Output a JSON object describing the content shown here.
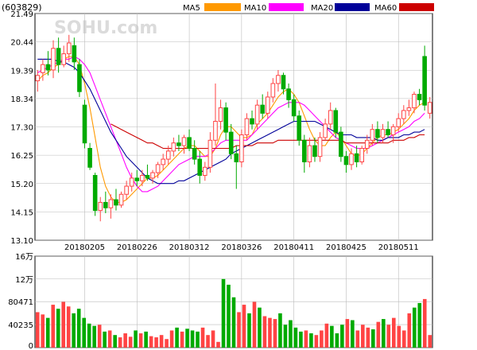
{
  "stock_code": "(603829)",
  "watermark": "SOHU.com",
  "legend": [
    {
      "label": "MA5",
      "color": "#ff9900"
    },
    {
      "label": "MA10",
      "color": "#ff00ff"
    },
    {
      "label": "MA20",
      "color": "#000099"
    },
    {
      "label": "MA60",
      "color": "#cc0000"
    }
  ],
  "colors": {
    "up": "#ff4444",
    "down": "#00aa00",
    "grid": "#bbbbbb",
    "border": "#000000"
  },
  "chart_data": [
    {
      "type": "candlestick",
      "title": "(603829)",
      "ylim": [
        13.1,
        21.49
      ],
      "yticks": [
        "21.49",
        "20.44",
        "19.39",
        "18.34",
        "17.30",
        "16.25",
        "15.20",
        "14.15",
        "13.10"
      ],
      "xtick_labels": [
        "20180205",
        "20180226",
        "20180312",
        "20180326",
        "20180411",
        "20180425",
        "20180511"
      ],
      "xtick_index": [
        9,
        19,
        29,
        39,
        49,
        59,
        69
      ],
      "candles": [
        {
          "o": 19.0,
          "h": 19.4,
          "l": 18.6,
          "c": 19.2
        },
        {
          "o": 19.3,
          "h": 19.8,
          "l": 19.0,
          "c": 19.6
        },
        {
          "o": 19.6,
          "h": 20.1,
          "l": 19.2,
          "c": 19.4
        },
        {
          "o": 19.4,
          "h": 20.5,
          "l": 19.1,
          "c": 20.2
        },
        {
          "o": 20.2,
          "h": 20.6,
          "l": 19.3,
          "c": 19.6
        },
        {
          "o": 19.6,
          "h": 20.3,
          "l": 19.5,
          "c": 20.0
        },
        {
          "o": 20.0,
          "h": 20.7,
          "l": 19.7,
          "c": 20.4
        },
        {
          "o": 20.3,
          "h": 20.6,
          "l": 19.4,
          "c": 19.7
        },
        {
          "o": 19.6,
          "h": 19.8,
          "l": 18.4,
          "c": 18.6
        },
        {
          "o": 18.1,
          "h": 18.3,
          "l": 16.5,
          "c": 16.7
        },
        {
          "o": 16.5,
          "h": 16.7,
          "l": 15.7,
          "c": 15.8
        },
        {
          "o": 15.5,
          "h": 15.6,
          "l": 14.0,
          "c": 14.2
        },
        {
          "o": 14.2,
          "h": 14.7,
          "l": 13.8,
          "c": 14.5
        },
        {
          "o": 14.5,
          "h": 14.9,
          "l": 14.1,
          "c": 14.3
        },
        {
          "o": 14.3,
          "h": 14.8,
          "l": 13.9,
          "c": 14.6
        },
        {
          "o": 14.6,
          "h": 15.0,
          "l": 14.2,
          "c": 14.4
        },
        {
          "o": 14.4,
          "h": 14.9,
          "l": 14.3,
          "c": 14.8
        },
        {
          "o": 14.8,
          "h": 15.3,
          "l": 14.6,
          "c": 15.1
        },
        {
          "o": 15.1,
          "h": 15.6,
          "l": 14.9,
          "c": 15.4
        },
        {
          "o": 15.4,
          "h": 15.7,
          "l": 15.1,
          "c": 15.3
        },
        {
          "o": 15.3,
          "h": 15.7,
          "l": 15.1,
          "c": 15.5
        },
        {
          "o": 15.5,
          "h": 15.9,
          "l": 15.3,
          "c": 15.4
        },
        {
          "o": 15.4,
          "h": 15.7,
          "l": 15.2,
          "c": 15.6
        },
        {
          "o": 15.6,
          "h": 16.0,
          "l": 15.4,
          "c": 15.9
        },
        {
          "o": 15.9,
          "h": 16.3,
          "l": 15.7,
          "c": 16.1
        },
        {
          "o": 16.1,
          "h": 16.6,
          "l": 15.9,
          "c": 16.4
        },
        {
          "o": 16.4,
          "h": 16.9,
          "l": 16.2,
          "c": 16.7
        },
        {
          "o": 16.7,
          "h": 17.0,
          "l": 16.4,
          "c": 16.6
        },
        {
          "o": 16.6,
          "h": 17.0,
          "l": 16.3,
          "c": 16.9
        },
        {
          "o": 16.9,
          "h": 17.2,
          "l": 16.4,
          "c": 16.5
        },
        {
          "o": 16.5,
          "h": 16.8,
          "l": 15.9,
          "c": 16.1
        },
        {
          "o": 16.1,
          "h": 16.4,
          "l": 15.2,
          "c": 15.5
        },
        {
          "o": 15.5,
          "h": 16.0,
          "l": 15.3,
          "c": 15.8
        },
        {
          "o": 15.8,
          "h": 17.1,
          "l": 15.6,
          "c": 16.8
        },
        {
          "o": 16.8,
          "h": 18.9,
          "l": 16.6,
          "c": 17.5
        },
        {
          "o": 17.5,
          "h": 18.3,
          "l": 17.2,
          "c": 18.0
        },
        {
          "o": 18.0,
          "h": 18.2,
          "l": 16.8,
          "c": 17.1
        },
        {
          "o": 17.1,
          "h": 17.4,
          "l": 16.1,
          "c": 16.3
        },
        {
          "o": 16.3,
          "h": 16.6,
          "l": 15.0,
          "c": 16.0
        },
        {
          "o": 16.0,
          "h": 17.2,
          "l": 15.8,
          "c": 17.0
        },
        {
          "o": 17.0,
          "h": 17.8,
          "l": 16.8,
          "c": 17.6
        },
        {
          "o": 17.6,
          "h": 17.9,
          "l": 17.2,
          "c": 17.4
        },
        {
          "o": 17.4,
          "h": 18.3,
          "l": 17.2,
          "c": 18.1
        },
        {
          "o": 18.1,
          "h": 18.5,
          "l": 17.6,
          "c": 17.8
        },
        {
          "o": 17.8,
          "h": 18.6,
          "l": 17.6,
          "c": 18.4
        },
        {
          "o": 18.4,
          "h": 19.1,
          "l": 18.2,
          "c": 18.9
        },
        {
          "o": 18.9,
          "h": 19.4,
          "l": 18.6,
          "c": 19.2
        },
        {
          "o": 19.2,
          "h": 19.3,
          "l": 18.5,
          "c": 18.7
        },
        {
          "o": 18.7,
          "h": 18.9,
          "l": 18.0,
          "c": 18.3
        },
        {
          "o": 18.3,
          "h": 18.5,
          "l": 17.5,
          "c": 17.7
        },
        {
          "o": 17.7,
          "h": 17.9,
          "l": 16.6,
          "c": 16.8
        },
        {
          "o": 16.8,
          "h": 17.0,
          "l": 15.6,
          "c": 16.0
        },
        {
          "o": 16.0,
          "h": 16.9,
          "l": 15.8,
          "c": 16.6
        },
        {
          "o": 16.6,
          "h": 16.9,
          "l": 16.0,
          "c": 16.2
        },
        {
          "o": 16.2,
          "h": 17.1,
          "l": 16.0,
          "c": 16.9
        },
        {
          "o": 16.9,
          "h": 17.6,
          "l": 16.8,
          "c": 17.4
        },
        {
          "o": 17.4,
          "h": 18.2,
          "l": 17.2,
          "c": 17.9
        },
        {
          "o": 17.9,
          "h": 18.0,
          "l": 16.9,
          "c": 17.1
        },
        {
          "o": 17.1,
          "h": 17.3,
          "l": 16.0,
          "c": 16.2
        },
        {
          "o": 16.2,
          "h": 16.4,
          "l": 15.6,
          "c": 15.9
        },
        {
          "o": 15.9,
          "h": 16.5,
          "l": 15.7,
          "c": 16.3
        },
        {
          "o": 16.3,
          "h": 16.6,
          "l": 15.8,
          "c": 16.0
        },
        {
          "o": 16.0,
          "h": 16.6,
          "l": 15.9,
          "c": 16.5
        },
        {
          "o": 16.5,
          "h": 17.0,
          "l": 16.3,
          "c": 16.8
        },
        {
          "o": 16.8,
          "h": 17.4,
          "l": 16.6,
          "c": 17.2
        },
        {
          "o": 17.2,
          "h": 17.5,
          "l": 16.7,
          "c": 16.9
        },
        {
          "o": 16.9,
          "h": 17.4,
          "l": 16.7,
          "c": 17.2
        },
        {
          "o": 17.2,
          "h": 17.5,
          "l": 16.9,
          "c": 17.0
        },
        {
          "o": 17.0,
          "h": 17.4,
          "l": 16.7,
          "c": 17.3
        },
        {
          "o": 17.3,
          "h": 17.8,
          "l": 17.1,
          "c": 17.6
        },
        {
          "o": 17.6,
          "h": 18.1,
          "l": 17.4,
          "c": 17.9
        },
        {
          "o": 17.9,
          "h": 18.3,
          "l": 17.7,
          "c": 18.0
        },
        {
          "o": 18.0,
          "h": 18.6,
          "l": 17.8,
          "c": 18.5
        },
        {
          "o": 18.5,
          "h": 18.7,
          "l": 18.1,
          "c": 18.3
        },
        {
          "o": 19.9,
          "h": 20.3,
          "l": 17.9,
          "c": 18.1
        },
        {
          "o": 17.8,
          "h": 18.4,
          "l": 17.6,
          "c": 18.2
        }
      ],
      "ma": {
        "MA5": [
          19.0,
          19.2,
          19.3,
          19.5,
          19.6,
          19.8,
          19.9,
          19.9,
          19.6,
          18.9,
          18.0,
          16.9,
          15.8,
          15.1,
          14.7,
          14.5,
          14.5,
          14.6,
          14.8,
          15.0,
          15.2,
          15.4,
          15.4,
          15.5,
          15.7,
          15.9,
          16.1,
          16.3,
          16.5,
          16.6,
          16.6,
          16.4,
          16.2,
          16.2,
          16.5,
          17.0,
          17.3,
          17.3,
          17.1,
          16.9,
          16.9,
          17.0,
          17.4,
          17.6,
          17.8,
          18.1,
          18.4,
          18.6,
          18.7,
          18.5,
          18.2,
          17.7,
          17.2,
          16.8,
          16.6,
          16.6,
          16.9,
          17.1,
          16.9,
          16.6,
          16.3,
          16.2,
          16.3,
          16.5,
          16.7,
          16.9,
          17.0,
          17.0,
          17.1,
          17.2,
          17.4,
          17.6,
          17.9,
          18.1,
          18.2
        ],
        "MA10": [
          19.3,
          19.4,
          19.5,
          19.6,
          19.7,
          19.8,
          19.8,
          19.9,
          19.8,
          19.6,
          19.3,
          18.8,
          18.3,
          17.8,
          17.3,
          16.8,
          16.3,
          15.8,
          15.4,
          15.1,
          14.9,
          14.9,
          15.0,
          15.1,
          15.3,
          15.5,
          15.7,
          15.9,
          16.0,
          16.1,
          16.2,
          16.2,
          16.2,
          16.3,
          16.5,
          16.7,
          16.8,
          16.8,
          16.8,
          16.8,
          16.8,
          17.0,
          17.2,
          17.4,
          17.6,
          17.8,
          18.0,
          18.1,
          18.2,
          18.2,
          18.2,
          18.1,
          17.9,
          17.7,
          17.5,
          17.3,
          17.1,
          16.9,
          16.8,
          16.7,
          16.6,
          16.5,
          16.5,
          16.5,
          16.6,
          16.7,
          16.8,
          16.9,
          17.0,
          17.1,
          17.2,
          17.3,
          17.5,
          17.6,
          17.8
        ],
        "MA20": [
          19.8,
          19.8,
          19.8,
          19.8,
          19.7,
          19.7,
          19.6,
          19.5,
          19.3,
          19.0,
          18.7,
          18.3,
          17.9,
          17.5,
          17.1,
          16.8,
          16.5,
          16.2,
          16.0,
          15.8,
          15.6,
          15.4,
          15.3,
          15.2,
          15.2,
          15.2,
          15.2,
          15.3,
          15.3,
          15.4,
          15.5,
          15.6,
          15.7,
          15.8,
          15.9,
          16.0,
          16.1,
          16.3,
          16.4,
          16.5,
          16.6,
          16.7,
          16.8,
          16.9,
          17.0,
          17.1,
          17.2,
          17.3,
          17.4,
          17.5,
          17.5,
          17.5,
          17.5,
          17.5,
          17.4,
          17.3,
          17.2,
          17.1,
          17.0,
          17.0,
          17.0,
          16.9,
          16.9,
          16.9,
          16.9,
          16.8,
          16.8,
          16.9,
          16.9,
          16.9,
          17.0,
          17.0,
          17.1,
          17.1,
          17.2
        ],
        "MA60": [
          null,
          null,
          null,
          null,
          null,
          null,
          null,
          null,
          null,
          null,
          null,
          null,
          null,
          null,
          17.4,
          17.3,
          17.2,
          17.1,
          17.0,
          16.9,
          16.8,
          16.7,
          16.7,
          16.6,
          16.5,
          16.5,
          16.5,
          16.5,
          16.5,
          16.5,
          16.5,
          16.5,
          16.5,
          16.5,
          16.5,
          16.5,
          16.5,
          16.5,
          16.6,
          16.6,
          16.6,
          16.6,
          16.7,
          16.7,
          16.7,
          16.7,
          16.8,
          16.8,
          16.8,
          16.8,
          16.8,
          16.8,
          16.8,
          16.8,
          16.8,
          16.8,
          16.8,
          16.8,
          16.8,
          16.7,
          16.7,
          16.7,
          16.7,
          16.7,
          16.7,
          16.7,
          16.7,
          16.7,
          16.8,
          16.8,
          16.8,
          16.9,
          16.9,
          17.0,
          17.0
        ]
      }
    },
    {
      "type": "bar",
      "ylabel": "volume",
      "ylim": [
        0,
        160000
      ],
      "yticks": [
        "16万",
        "12万",
        "80471",
        "40235",
        "0"
      ],
      "values": [
        62000,
        58000,
        52000,
        75000,
        68000,
        80000,
        72000,
        60000,
        68000,
        52000,
        42000,
        38000,
        40000,
        28000,
        30000,
        22000,
        18000,
        25000,
        19000,
        30000,
        25000,
        28000,
        20000,
        18000,
        22000,
        15000,
        30000,
        35000,
        28000,
        33000,
        30000,
        28000,
        35000,
        22000,
        30000,
        10000,
        120000,
        110000,
        88000,
        62000,
        75000,
        60000,
        80000,
        70000,
        55000,
        52000,
        50000,
        60000,
        40000,
        48000,
        35000,
        28000,
        30000,
        25000,
        22000,
        30000,
        42000,
        38000,
        25000,
        40000,
        50000,
        48000,
        30000,
        40000,
        35000,
        32000,
        45000,
        50000,
        40000,
        52000,
        38000,
        30000,
        60000,
        70000,
        78000,
        85000,
        22000
      ]
    }
  ]
}
